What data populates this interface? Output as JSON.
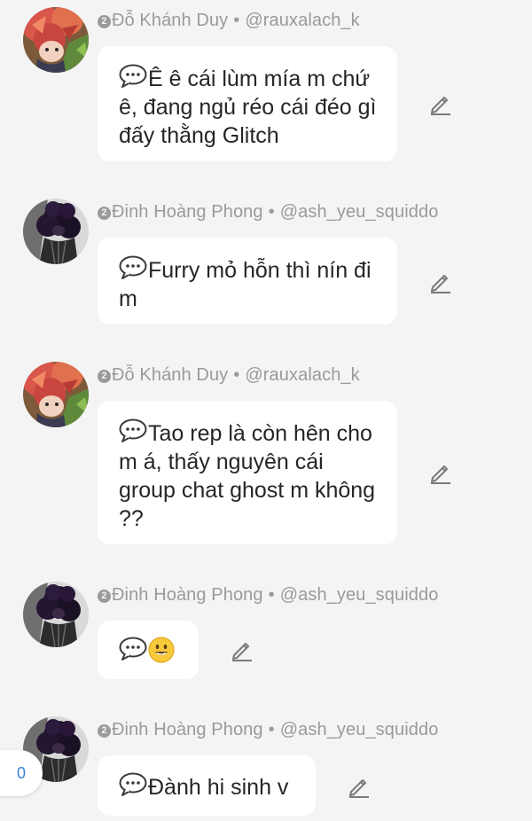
{
  "messages": [
    {
      "name": "Đỗ Khánh Duy",
      "handle": "@rauxalach_k",
      "level": "2",
      "text": "Ê ê cái lùm mía m chứ ê, đang ngủ réo cái đéo gì đấy thằng Glitch",
      "avatar": "red-hair-avatar"
    },
    {
      "name": "Đinh Hoàng Phong",
      "handle": "@ash_yeu_squiddo",
      "level": "2",
      "text": "Furry mỏ hỗn thì nín đi m",
      "avatar": "dark-hair-avatar"
    },
    {
      "name": "Đỗ Khánh Duy",
      "handle": "@rauxalach_k",
      "level": "2",
      "text": "Tao rep là còn hên cho m á, thấy nguyên cái group chat ghost m không ??",
      "avatar": "red-hair-avatar"
    },
    {
      "name": "Đinh Hoàng Phong",
      "handle": "@ash_yeu_squiddo",
      "level": "2",
      "text": "",
      "emoji": "slightly-smiling-face",
      "avatar": "dark-hair-avatar"
    },
    {
      "name": "Đinh Hoàng Phong",
      "handle": "@ash_yeu_squiddo",
      "level": "2",
      "text": "Đành hi sinh v",
      "avatar": "dark-hair-avatar"
    }
  ],
  "separator": "•",
  "counter": "0",
  "icons": {
    "bubble": "speech-balloon-icon",
    "edit": "pencil-icon"
  },
  "colors": {
    "background": "#f4f4f4",
    "bubble": "#ffffff",
    "meta": "#9a9a9a",
    "counter": "#3b82d6"
  }
}
